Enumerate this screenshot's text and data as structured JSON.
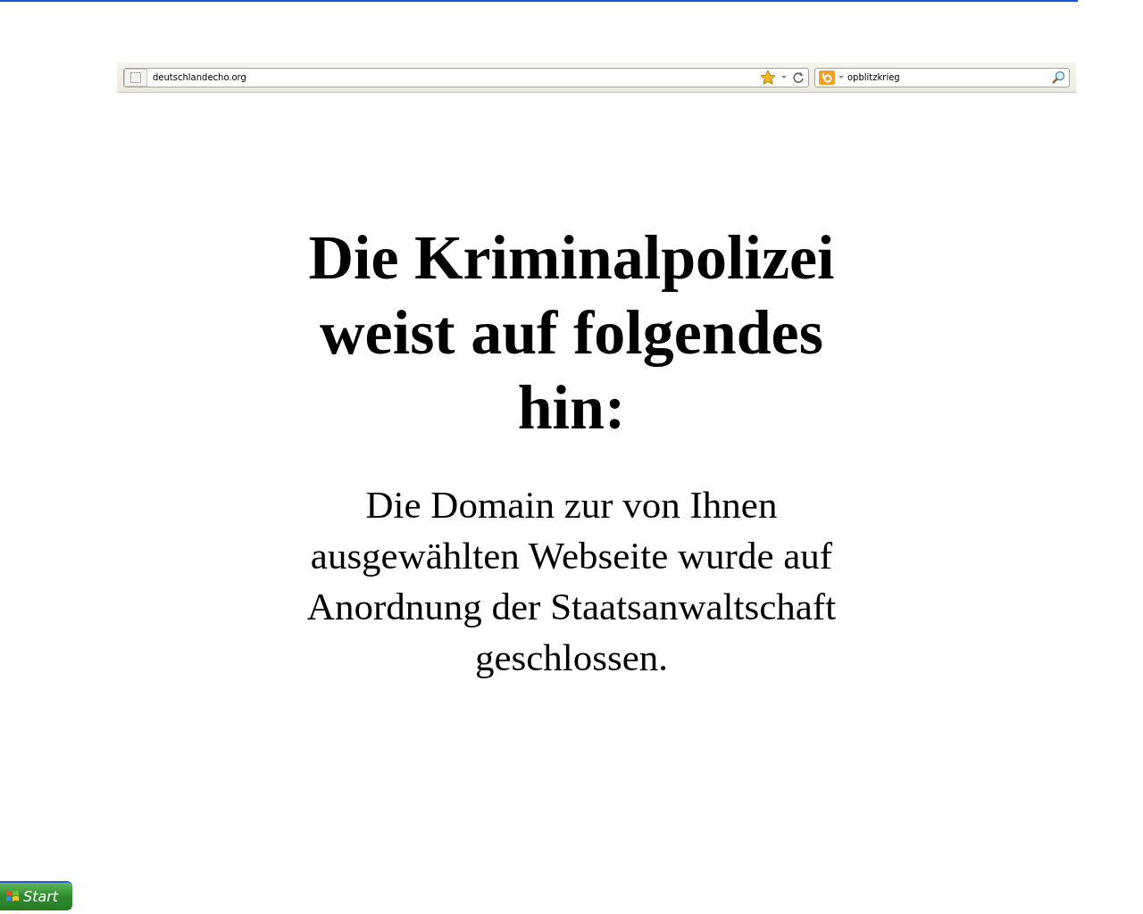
{
  "browser": {
    "address": "deutschlandecho.org",
    "bookmarked": true,
    "search_query": "opblitzkrieg"
  },
  "page": {
    "heading": "Die Kriminalpolizei weist auf folgendes hin:",
    "message": "Die Domain zur von Ihnen ausgewählten Webseite wurde auf Anordnung der Staatsanwaltschaft geschlossen."
  },
  "taskbar": {
    "start_label": "Start"
  }
}
